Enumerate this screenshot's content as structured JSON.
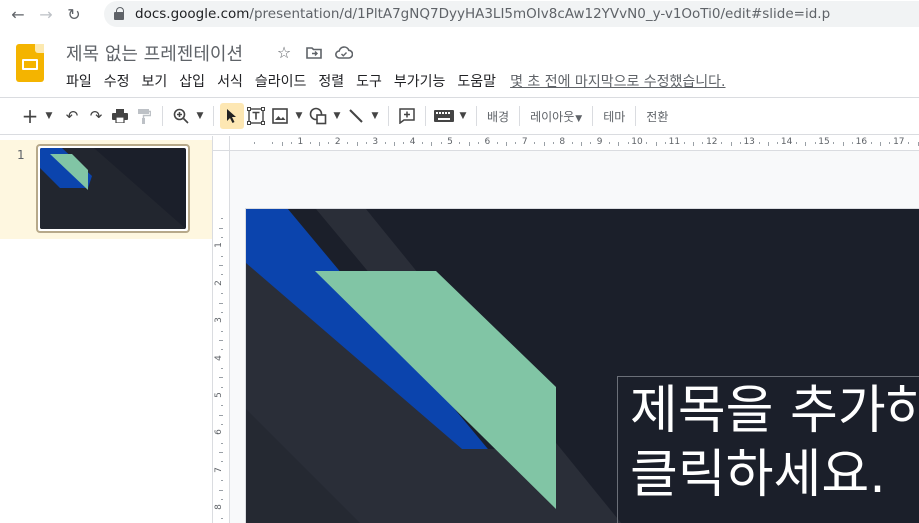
{
  "browser": {
    "url_host": "docs.google.com",
    "url_path": "/presentation/d/1PltA7gNQ7DyyHA3LI5mOIv8cAw12YVvN0_y-v1OoTi0/edit#slide=id.p",
    "back_icon": "arrow-left-icon",
    "forward_icon": "arrow-right-icon",
    "reload_icon": "reload-icon"
  },
  "app": {
    "doc_title": "제목 없는 프레젠테이션",
    "menu": [
      "파일",
      "수정",
      "보기",
      "삽입",
      "서식",
      "슬라이드",
      "정렬",
      "도구",
      "부가기능",
      "도움말"
    ],
    "last_edit": "몇 초 전에 마지막으로 수정했습니다."
  },
  "toolbar": {
    "background_label": "배경",
    "layout_label": "레이아웃",
    "theme_label": "테마",
    "transition_label": "전환"
  },
  "filmstrip": {
    "slides": [
      {
        "number": "1"
      }
    ]
  },
  "rulers": {
    "horizontal": [
      "1",
      "2",
      "3",
      "4",
      "5",
      "6",
      "7",
      "8",
      "9",
      "10",
      "11",
      "12",
      "13",
      "14",
      "15",
      "16",
      "17"
    ],
    "vertical": [
      "1",
      "2",
      "3",
      "4",
      "5",
      "6",
      "7",
      "8"
    ]
  },
  "slide": {
    "title_line1": "제목을 추가하",
    "title_line2": "클릭하세요.",
    "colors": {
      "background": "#1b1f2a",
      "blue": "#0b44ad",
      "green": "#81c5a5",
      "dark_band": "#2a2e38"
    }
  }
}
